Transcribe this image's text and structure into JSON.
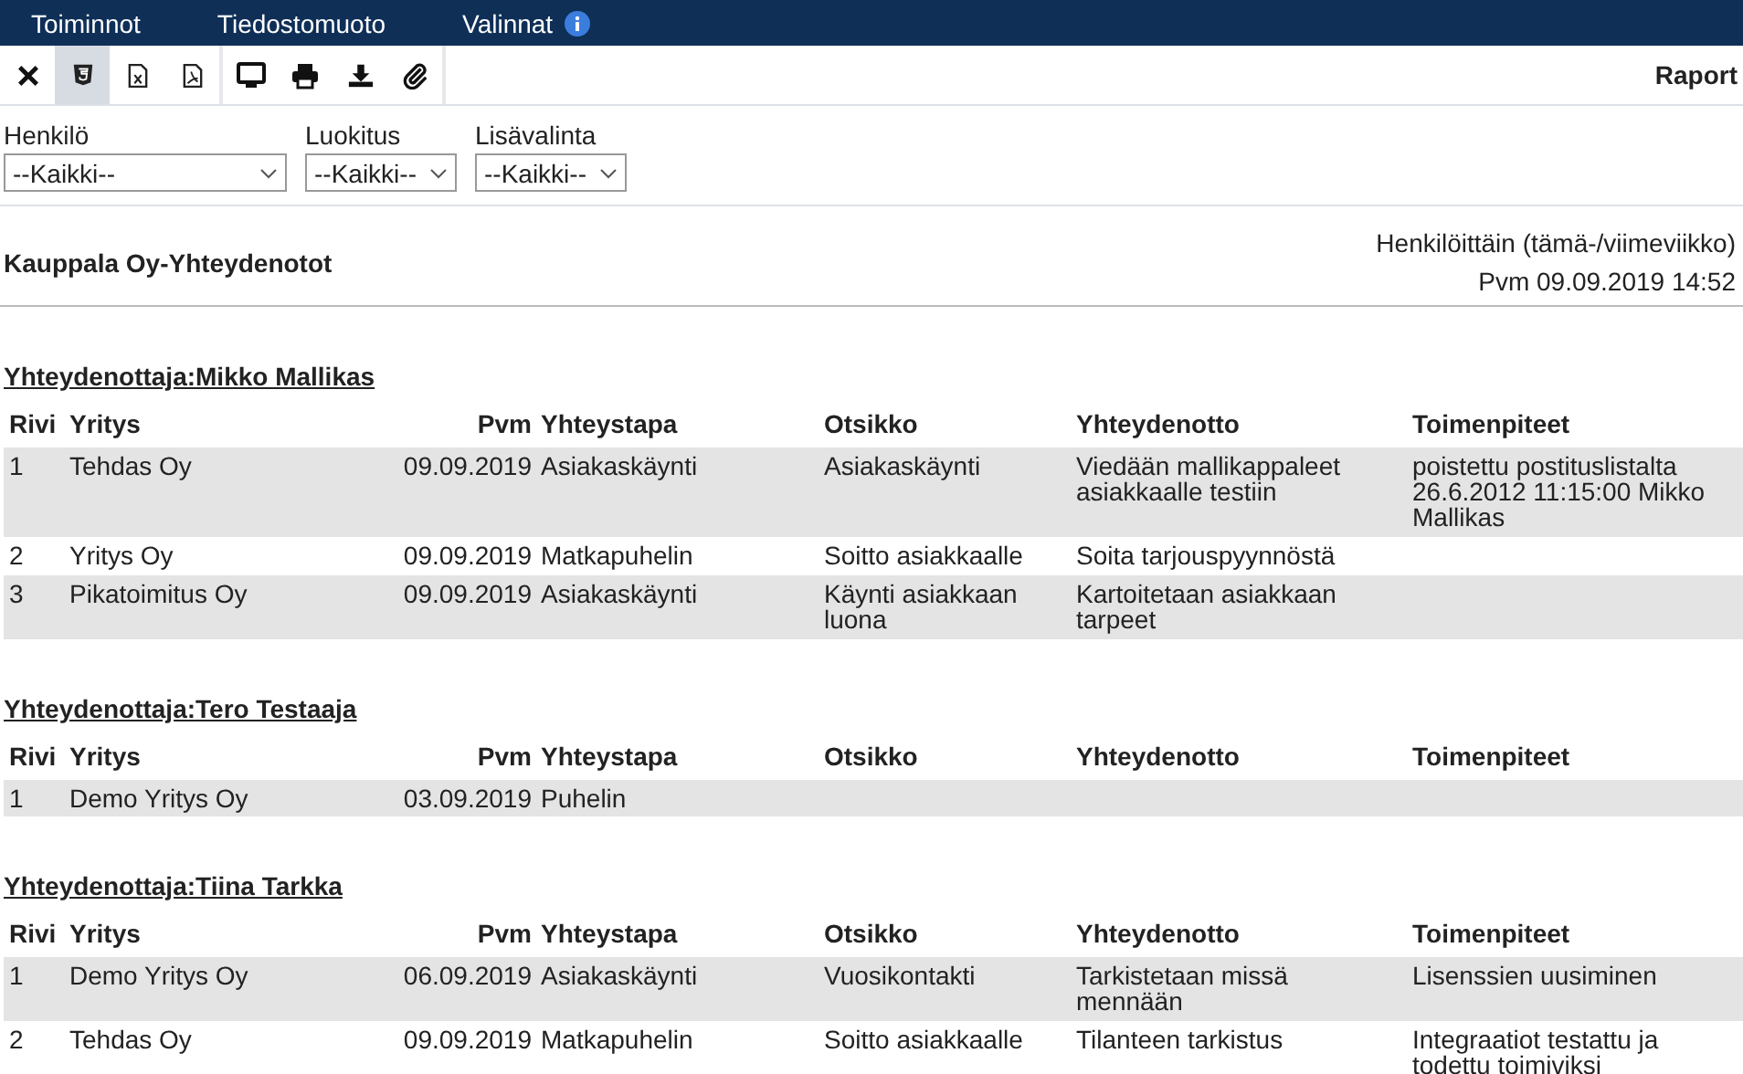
{
  "menu": [
    {
      "label": "Toiminnot",
      "info": false
    },
    {
      "label": "Tiedostomuoto",
      "info": false
    },
    {
      "label": "Valinnat",
      "info": true
    }
  ],
  "toolbar": {
    "groups": [
      [
        {
          "kind": "close",
          "selected": false
        },
        {
          "kind": "html",
          "selected": true
        },
        {
          "kind": "excel",
          "selected": false
        },
        {
          "kind": "pdf",
          "selected": false
        }
      ],
      [
        {
          "kind": "screen",
          "selected": false
        },
        {
          "kind": "print",
          "selected": false
        },
        {
          "kind": "download",
          "selected": false
        },
        {
          "kind": "attach",
          "selected": false
        }
      ]
    ],
    "title": "Raport"
  },
  "filters": [
    {
      "label": "Henkilö",
      "value": "--Kaikki--",
      "wide": true
    },
    {
      "label": "Luokitus",
      "value": "--Kaikki--",
      "wide": false
    },
    {
      "label": "Lisävalinta",
      "value": "--Kaikki--",
      "wide": false
    }
  ],
  "report": {
    "title": "Kauppala Oy-Yhteydenotot",
    "subtitle": "Henkilöittäin (tämä-/viimeviikko)",
    "date": "Pvm 09.09.2019 14:52"
  },
  "groups": [
    {
      "heading": "Yhteydenottaja:Mikko Mallikas",
      "columns": [
        "Rivi",
        "Yritys",
        "Pvm",
        "Yhteystapa",
        "Otsikko",
        "Yhteydenotto",
        "Toimenpiteet"
      ],
      "rows": [
        [
          "1",
          "Tehdas Oy",
          "09.09.2019",
          "Asiakaskäynti",
          "Asiakaskäynti",
          "Viedään mallikappaleet asiakkaalle testiin",
          "poistettu postituslistalta 26.6.2012 11:15:00 Mikko Mallikas"
        ],
        [
          "2",
          "Yritys Oy",
          "09.09.2019",
          "Matkapuhelin",
          "Soitto asiakkaalle",
          "Soita tarjouspyynnöstä",
          ""
        ],
        [
          "3",
          "Pikatoimitus Oy",
          "09.09.2019",
          "Asiakaskäynti",
          "Käynti asiakkaan luona",
          "Kartoitetaan asiakkaan tarpeet",
          ""
        ]
      ]
    },
    {
      "heading": "Yhteydenottaja:Tero Testaaja",
      "columns": [
        "Rivi",
        "Yritys",
        "Pvm",
        "Yhteystapa",
        "Otsikko",
        "Yhteydenotto",
        "Toimenpiteet"
      ],
      "rows": [
        [
          "1",
          "Demo Yritys Oy",
          "03.09.2019",
          "Puhelin",
          "",
          "",
          ""
        ]
      ]
    },
    {
      "heading": "Yhteydenottaja:Tiina Tarkka",
      "columns": [
        "Rivi",
        "Yritys",
        "Pvm",
        "Yhteystapa",
        "Otsikko",
        "Yhteydenotto",
        "Toimenpiteet"
      ],
      "rows": [
        [
          "1",
          "Demo Yritys Oy",
          "06.09.2019",
          "Asiakaskäynti",
          "Vuosikontakti",
          "Tarkistetaan missä mennään",
          "Lisenssien uusiminen"
        ],
        [
          "2",
          "Tehdas Oy",
          "09.09.2019",
          "Matkapuhelin",
          "Soitto asiakkaalle",
          "Tilanteen tarkistus",
          "Integraatiot testattu ja todettu toimiviksi"
        ]
      ]
    }
  ]
}
